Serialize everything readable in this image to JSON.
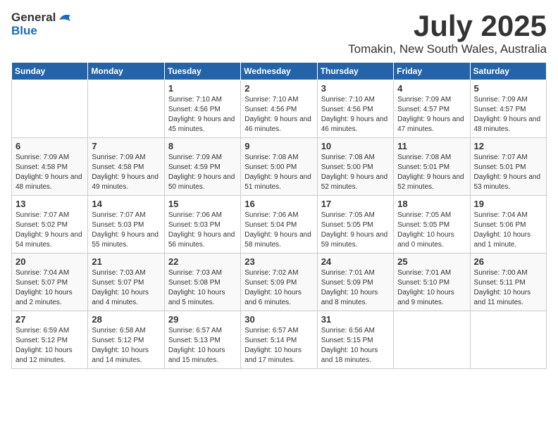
{
  "header": {
    "logo": {
      "general": "General",
      "blue": "Blue"
    },
    "title": "July 2025",
    "location": "Tomakin, New South Wales, Australia"
  },
  "calendar": {
    "days_of_week": [
      "Sunday",
      "Monday",
      "Tuesday",
      "Wednesday",
      "Thursday",
      "Friday",
      "Saturday"
    ],
    "weeks": [
      [
        {
          "day": "",
          "info": ""
        },
        {
          "day": "",
          "info": ""
        },
        {
          "day": "1",
          "info": "Sunrise: 7:10 AM\nSunset: 4:56 PM\nDaylight: 9 hours and 45 minutes."
        },
        {
          "day": "2",
          "info": "Sunrise: 7:10 AM\nSunset: 4:56 PM\nDaylight: 9 hours and 46 minutes."
        },
        {
          "day": "3",
          "info": "Sunrise: 7:10 AM\nSunset: 4:56 PM\nDaylight: 9 hours and 46 minutes."
        },
        {
          "day": "4",
          "info": "Sunrise: 7:09 AM\nSunset: 4:57 PM\nDaylight: 9 hours and 47 minutes."
        },
        {
          "day": "5",
          "info": "Sunrise: 7:09 AM\nSunset: 4:57 PM\nDaylight: 9 hours and 48 minutes."
        }
      ],
      [
        {
          "day": "6",
          "info": "Sunrise: 7:09 AM\nSunset: 4:58 PM\nDaylight: 9 hours and 48 minutes."
        },
        {
          "day": "7",
          "info": "Sunrise: 7:09 AM\nSunset: 4:58 PM\nDaylight: 9 hours and 49 minutes."
        },
        {
          "day": "8",
          "info": "Sunrise: 7:09 AM\nSunset: 4:59 PM\nDaylight: 9 hours and 50 minutes."
        },
        {
          "day": "9",
          "info": "Sunrise: 7:08 AM\nSunset: 5:00 PM\nDaylight: 9 hours and 51 minutes."
        },
        {
          "day": "10",
          "info": "Sunrise: 7:08 AM\nSunset: 5:00 PM\nDaylight: 9 hours and 52 minutes."
        },
        {
          "day": "11",
          "info": "Sunrise: 7:08 AM\nSunset: 5:01 PM\nDaylight: 9 hours and 52 minutes."
        },
        {
          "day": "12",
          "info": "Sunrise: 7:07 AM\nSunset: 5:01 PM\nDaylight: 9 hours and 53 minutes."
        }
      ],
      [
        {
          "day": "13",
          "info": "Sunrise: 7:07 AM\nSunset: 5:02 PM\nDaylight: 9 hours and 54 minutes."
        },
        {
          "day": "14",
          "info": "Sunrise: 7:07 AM\nSunset: 5:03 PM\nDaylight: 9 hours and 55 minutes."
        },
        {
          "day": "15",
          "info": "Sunrise: 7:06 AM\nSunset: 5:03 PM\nDaylight: 9 hours and 56 minutes."
        },
        {
          "day": "16",
          "info": "Sunrise: 7:06 AM\nSunset: 5:04 PM\nDaylight: 9 hours and 58 minutes."
        },
        {
          "day": "17",
          "info": "Sunrise: 7:05 AM\nSunset: 5:05 PM\nDaylight: 9 hours and 59 minutes."
        },
        {
          "day": "18",
          "info": "Sunrise: 7:05 AM\nSunset: 5:05 PM\nDaylight: 10 hours and 0 minutes."
        },
        {
          "day": "19",
          "info": "Sunrise: 7:04 AM\nSunset: 5:06 PM\nDaylight: 10 hours and 1 minute."
        }
      ],
      [
        {
          "day": "20",
          "info": "Sunrise: 7:04 AM\nSunset: 5:07 PM\nDaylight: 10 hours and 2 minutes."
        },
        {
          "day": "21",
          "info": "Sunrise: 7:03 AM\nSunset: 5:07 PM\nDaylight: 10 hours and 4 minutes."
        },
        {
          "day": "22",
          "info": "Sunrise: 7:03 AM\nSunset: 5:08 PM\nDaylight: 10 hours and 5 minutes."
        },
        {
          "day": "23",
          "info": "Sunrise: 7:02 AM\nSunset: 5:09 PM\nDaylight: 10 hours and 6 minutes."
        },
        {
          "day": "24",
          "info": "Sunrise: 7:01 AM\nSunset: 5:09 PM\nDaylight: 10 hours and 8 minutes."
        },
        {
          "day": "25",
          "info": "Sunrise: 7:01 AM\nSunset: 5:10 PM\nDaylight: 10 hours and 9 minutes."
        },
        {
          "day": "26",
          "info": "Sunrise: 7:00 AM\nSunset: 5:11 PM\nDaylight: 10 hours and 11 minutes."
        }
      ],
      [
        {
          "day": "27",
          "info": "Sunrise: 6:59 AM\nSunset: 5:12 PM\nDaylight: 10 hours and 12 minutes."
        },
        {
          "day": "28",
          "info": "Sunrise: 6:58 AM\nSunset: 5:12 PM\nDaylight: 10 hours and 14 minutes."
        },
        {
          "day": "29",
          "info": "Sunrise: 6:57 AM\nSunset: 5:13 PM\nDaylight: 10 hours and 15 minutes."
        },
        {
          "day": "30",
          "info": "Sunrise: 6:57 AM\nSunset: 5:14 PM\nDaylight: 10 hours and 17 minutes."
        },
        {
          "day": "31",
          "info": "Sunrise: 6:56 AM\nSunset: 5:15 PM\nDaylight: 10 hours and 18 minutes."
        },
        {
          "day": "",
          "info": ""
        },
        {
          "day": "",
          "info": ""
        }
      ]
    ]
  }
}
